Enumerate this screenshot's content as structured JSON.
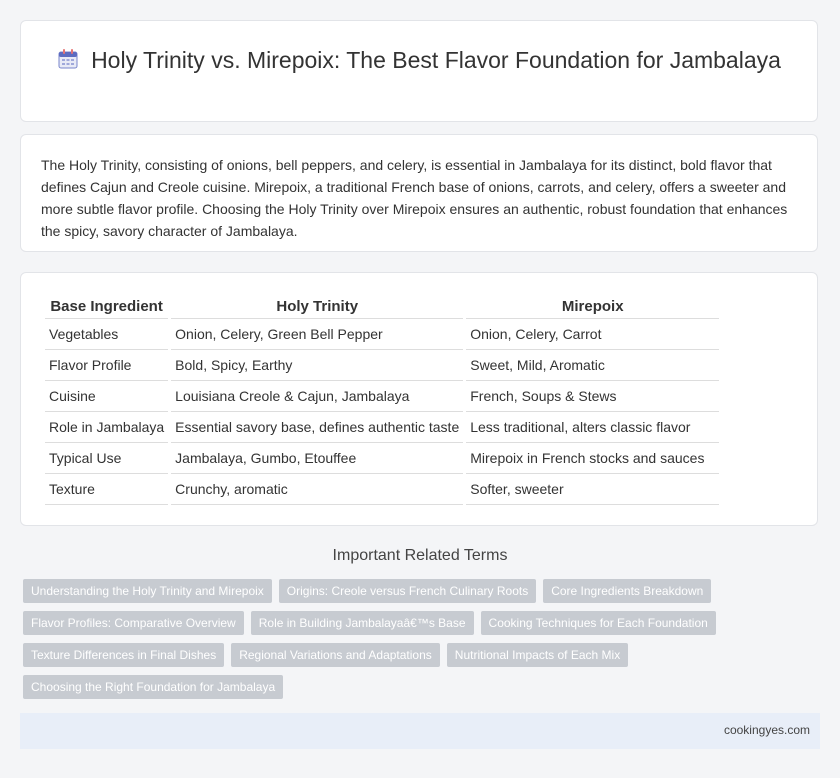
{
  "header": {
    "icon": "calendar-icon",
    "title": "Holy Trinity vs. Mirepoix: The Best Flavor Foundation for Jambalaya"
  },
  "intro": {
    "text": "The Holy Trinity, consisting of onions, bell peppers, and celery, is essential in Jambalaya for its distinct, bold flavor that defines Cajun and Creole cuisine. Mirepoix, a traditional French base of onions, carrots, and celery, offers a sweeter and more subtle flavor profile. Choosing the Holy Trinity over Mirepoix ensures an authentic, robust foundation that enhances the spicy, savory character of Jambalaya."
  },
  "table": {
    "headers": [
      "Base Ingredient",
      "Holy Trinity",
      "Mirepoix"
    ],
    "rows": [
      [
        "Vegetables",
        "Onion, Celery, Green Bell Pepper",
        "Onion, Celery, Carrot"
      ],
      [
        "Flavor Profile",
        "Bold, Spicy, Earthy",
        "Sweet, Mild, Aromatic"
      ],
      [
        "Cuisine",
        "Louisiana Creole & Cajun, Jambalaya",
        "French, Soups & Stews"
      ],
      [
        "Role in Jambalaya",
        "Essential savory base, defines authentic taste",
        "Less traditional, alters classic flavor"
      ],
      [
        "Typical Use",
        "Jambalaya, Gumbo, Etouffee",
        "Mirepoix in French stocks and sauces"
      ],
      [
        "Texture",
        "Crunchy, aromatic",
        "Softer, sweeter"
      ]
    ]
  },
  "related": {
    "title": "Important Related Terms",
    "rows": [
      [
        "Understanding the Holy Trinity and Mirepoix",
        "Origins: Creole versus French Culinary Roots",
        "Core Ingredients Breakdown"
      ],
      [
        "Flavor Profiles: Comparative Overview",
        "Role in Building Jambalayaâ€™s Base",
        "Cooking Techniques for Each Foundation"
      ],
      [
        "Texture Differences in Final Dishes",
        "Regional Variations and Adaptations",
        "Nutritional Impacts of Each Mix"
      ],
      [
        "Choosing the Right Foundation for Jambalaya"
      ]
    ]
  },
  "footer": {
    "site": "cookingyes.com"
  }
}
